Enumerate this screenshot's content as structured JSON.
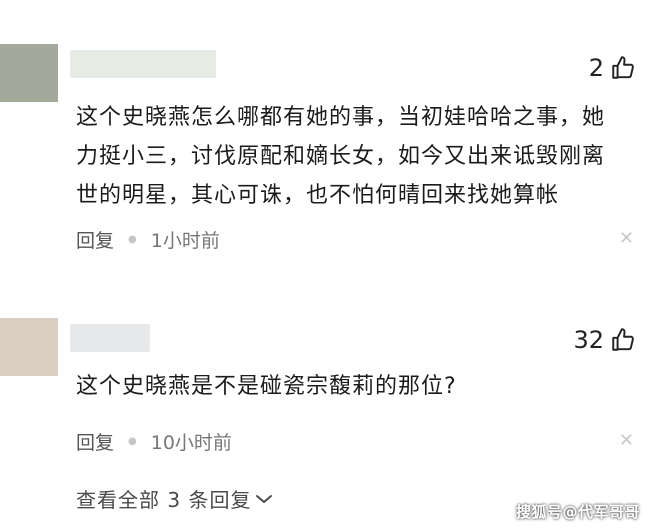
{
  "comments": [
    {
      "likes": "2",
      "text_lines": [
        "这个史晓燕怎么哪都有她的事，当初娃哈哈之事，她",
        "力挺小三，讨伐原配和嫡长女，如今又出来诋毁刚离",
        "世的明星，其心可诛，也不怕何晴回来找她算帐"
      ],
      "reply_label": "回复",
      "time": "1小时前",
      "colors": {
        "avatar": "#a3aa9c",
        "username_blur": "#e6ebe4"
      }
    },
    {
      "likes": "32",
      "text_lines": [
        "这个史晓燕是不是碰瓷宗馥莉的那位?"
      ],
      "reply_label": "回复",
      "time": "10小时前",
      "colors": {
        "avatar": "#dacfc2",
        "username_blur": "#e7e8ea"
      }
    }
  ],
  "view_replies": "查看全部 3 条回复",
  "watermark": "搜狐号@代军哥哥",
  "icons": {
    "like": "thumbs-up-icon",
    "close": "close-icon",
    "dot": "dot-separator",
    "expand": "chevron-down-icon"
  }
}
